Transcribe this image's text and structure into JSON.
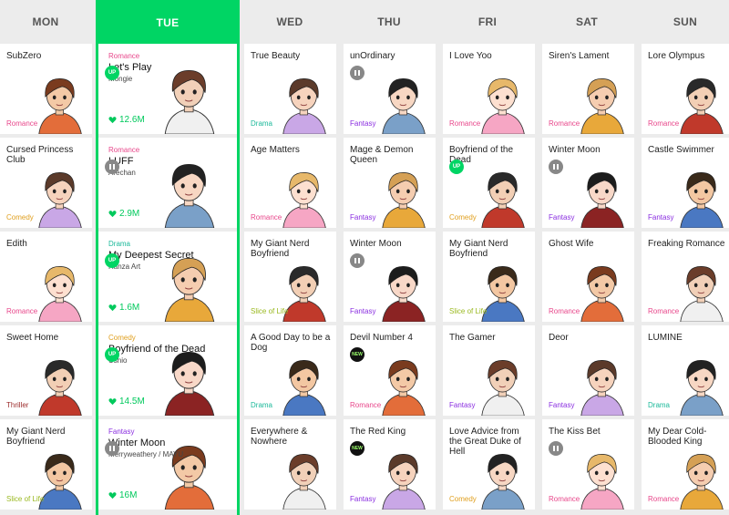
{
  "days": [
    {
      "label": "MON",
      "active": false
    },
    {
      "label": "TUE",
      "active": true
    },
    {
      "label": "WED",
      "active": false
    },
    {
      "label": "THU",
      "active": false
    },
    {
      "label": "FRI",
      "active": false
    },
    {
      "label": "SAT",
      "active": false
    },
    {
      "label": "SUN",
      "active": false
    }
  ],
  "colors": {
    "accent": "#00d564",
    "romance": "#e8478b",
    "drama": "#1bb99a",
    "fantasy": "#8a2ee0",
    "comedy": "#e0a020",
    "thriller": "#9c2b2b",
    "slice_of_life": "#9ab920"
  },
  "columns": {
    "mon": [
      {
        "title": "SubZero",
        "genre": "Romance",
        "badge": ""
      },
      {
        "title": "Cursed Princess Club",
        "genre": "Comedy",
        "badge": ""
      },
      {
        "title": "Edith",
        "genre": "Romance",
        "badge": ""
      },
      {
        "title": "Sweet Home",
        "genre": "Thriller",
        "badge": ""
      },
      {
        "title": "My Giant Nerd Boyfriend",
        "genre": "Slice of Life",
        "badge": ""
      }
    ],
    "tue": [
      {
        "genre": "Romance",
        "title": "Let's Play",
        "author": "Mongie",
        "badge": "UP",
        "likes": "12.6M"
      },
      {
        "genre": "Romance",
        "title": "LUFF",
        "author": "Arechan",
        "badge": "pause",
        "likes": "2.9M"
      },
      {
        "genre": "Drama",
        "title": "My Deepest Secret",
        "author": "Hanza Art",
        "badge": "UP",
        "likes": "1.6M"
      },
      {
        "genre": "Comedy",
        "title": "Boyfriend of the Dead",
        "author": "Ushio",
        "badge": "UP",
        "likes": "14.5M"
      },
      {
        "genre": "Fantasy",
        "title": "Winter Moon",
        "author": "Merryweathery / MAYU",
        "badge": "pause",
        "likes": "16M"
      }
    ],
    "wed": [
      {
        "title": "True Beauty",
        "genre": "Drama",
        "badge": ""
      },
      {
        "title": "Age Matters",
        "genre": "Romance",
        "badge": ""
      },
      {
        "title": "My Giant Nerd Boyfriend",
        "genre": "Slice of Life",
        "badge": ""
      },
      {
        "title": "A Good Day to be a Dog",
        "genre": "Drama",
        "badge": ""
      },
      {
        "title": "Everywhere & Nowhere",
        "genre": "",
        "badge": ""
      }
    ],
    "thu": [
      {
        "title": "unOrdinary",
        "genre": "Fantasy",
        "badge": "pause"
      },
      {
        "title": "Mage & Demon Queen",
        "genre": "Fantasy",
        "badge": ""
      },
      {
        "title": "Winter Moon",
        "genre": "Fantasy",
        "badge": "pause"
      },
      {
        "title": "Devil Number 4",
        "genre": "Romance",
        "badge": "NEW"
      },
      {
        "title": "The Red King",
        "genre": "Fantasy",
        "badge": "NEW"
      }
    ],
    "fri": [
      {
        "title": "I Love Yoo",
        "genre": "Romance",
        "badge": ""
      },
      {
        "title": "Boyfriend of the Dead",
        "genre": "Comedy",
        "badge": "UP"
      },
      {
        "title": "My Giant Nerd Boyfriend",
        "genre": "Slice of Life",
        "badge": ""
      },
      {
        "title": "The Gamer",
        "genre": "Fantasy",
        "badge": ""
      },
      {
        "title": "Love Advice from the Great Duke of Hell",
        "genre": "Comedy",
        "badge": ""
      }
    ],
    "sat": [
      {
        "title": "Siren's Lament",
        "genre": "Romance",
        "badge": ""
      },
      {
        "title": "Winter Moon",
        "genre": "Fantasy",
        "badge": "pause"
      },
      {
        "title": "Ghost Wife",
        "genre": "Romance",
        "badge": ""
      },
      {
        "title": "Deor",
        "genre": "Fantasy",
        "badge": ""
      },
      {
        "title": "The Kiss Bet",
        "genre": "Romance",
        "badge": "pause"
      }
    ],
    "sun": [
      {
        "title": "Lore Olympus",
        "genre": "Romance",
        "badge": ""
      },
      {
        "title": "Castle Swimmer",
        "genre": "Fantasy",
        "badge": ""
      },
      {
        "title": "Freaking Romance",
        "genre": "Romance",
        "badge": ""
      },
      {
        "title": "LUMINE",
        "genre": "Drama",
        "badge": ""
      },
      {
        "title": "My Dear Cold-Blooded King",
        "genre": "Romance",
        "badge": ""
      }
    ]
  }
}
